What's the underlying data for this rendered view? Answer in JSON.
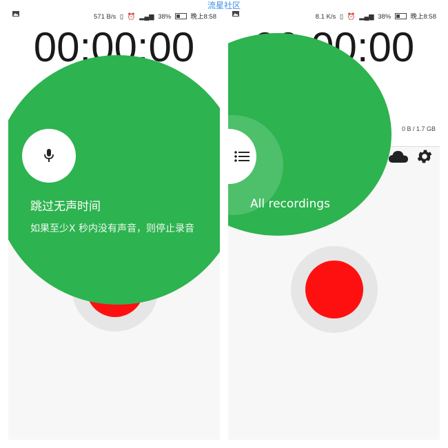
{
  "watermark": "流星社区",
  "left": {
    "status": {
      "speed": "571 B/s",
      "battery": "38%",
      "clock": "晚上8:58"
    },
    "timer": "00:00:00",
    "tap_target": {
      "title": "跳过无声时间",
      "description": "如果至少X 秒内没有声音，则停止录音",
      "icon": "microphone-icon"
    }
  },
  "right": {
    "status": {
      "speed": "8.1 K/s",
      "battery": "38%",
      "clock": "晚上8:58"
    },
    "timer": "00:00:00",
    "storage": "0 B / 1.7 GB",
    "tap_target": {
      "title": "All recordings",
      "icon": "list-icon"
    },
    "toolbar_icons": [
      "cloud-icon",
      "gear-icon"
    ]
  },
  "colors": {
    "accent_green": "#2db34f",
    "record_red": "#ff1010",
    "record_ring": "#e6e6e6",
    "background": "#f7f7f7"
  }
}
